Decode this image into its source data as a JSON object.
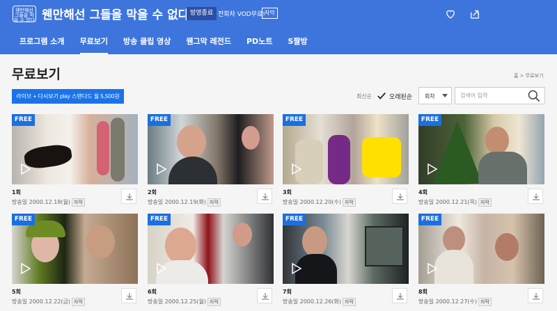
{
  "header": {
    "logo_text": "웬만해선 그들을 막을 수 없다",
    "title": "웬만해선 그들을 막을 수 없다",
    "status_badge": "방영종료",
    "notice": "전회차 VOD무료!",
    "subtitle_badge": "자막"
  },
  "nav": {
    "items": [
      {
        "label": "프로그램 소개"
      },
      {
        "label": "무료보기"
      },
      {
        "label": "방송 클립 영상"
      },
      {
        "label": "웬그막 레전드"
      },
      {
        "label": "PD노트"
      },
      {
        "label": "S짤방"
      }
    ],
    "active": "무료보기"
  },
  "page": {
    "title": "무료보기",
    "breadcrumb": "홈 > 무료보기"
  },
  "promo_button": "라이브 + 다시보기 play 스탠다드 월 5,500원",
  "sort": {
    "newest": "최신순",
    "oldest": "오래된순"
  },
  "search": {
    "select_value": "회차",
    "placeholder": "검색어 입력"
  },
  "episodes": [
    {
      "badge": "FREE",
      "title": "1회",
      "air_date": "방송일 2000.12.18(월)",
      "sub": "자막"
    },
    {
      "badge": "FREE",
      "title": "2회",
      "air_date": "방송일 2000.12.19(화)",
      "sub": "자막"
    },
    {
      "badge": "FREE",
      "title": "3회",
      "air_date": "방송일 2000.12.20(수)",
      "sub": "자막"
    },
    {
      "badge": "FREE",
      "title": "4회",
      "air_date": "방송일 2000.12.21(목)",
      "sub": "자막"
    },
    {
      "badge": "FREE",
      "title": "5회",
      "air_date": "방송일 2000.12.22(금)",
      "sub": "자막"
    },
    {
      "badge": "FREE",
      "title": "6회",
      "air_date": "방송일 2000.12.25(월)",
      "sub": "자막"
    },
    {
      "badge": "FREE",
      "title": "7회",
      "air_date": "방송일 2000.12.26(화)",
      "sub": "자막"
    },
    {
      "badge": "FREE",
      "title": "8회",
      "air_date": "방송일 2000.12.27(수)",
      "sub": "자막"
    }
  ],
  "colors": {
    "header": "#3d75dd",
    "accent": "#1b6fe0",
    "background": "#f5f5f5"
  },
  "icons": [
    "heart-icon",
    "share-icon",
    "check-icon",
    "chevron-down-icon",
    "search-icon",
    "play-icon",
    "download-icon"
  ]
}
